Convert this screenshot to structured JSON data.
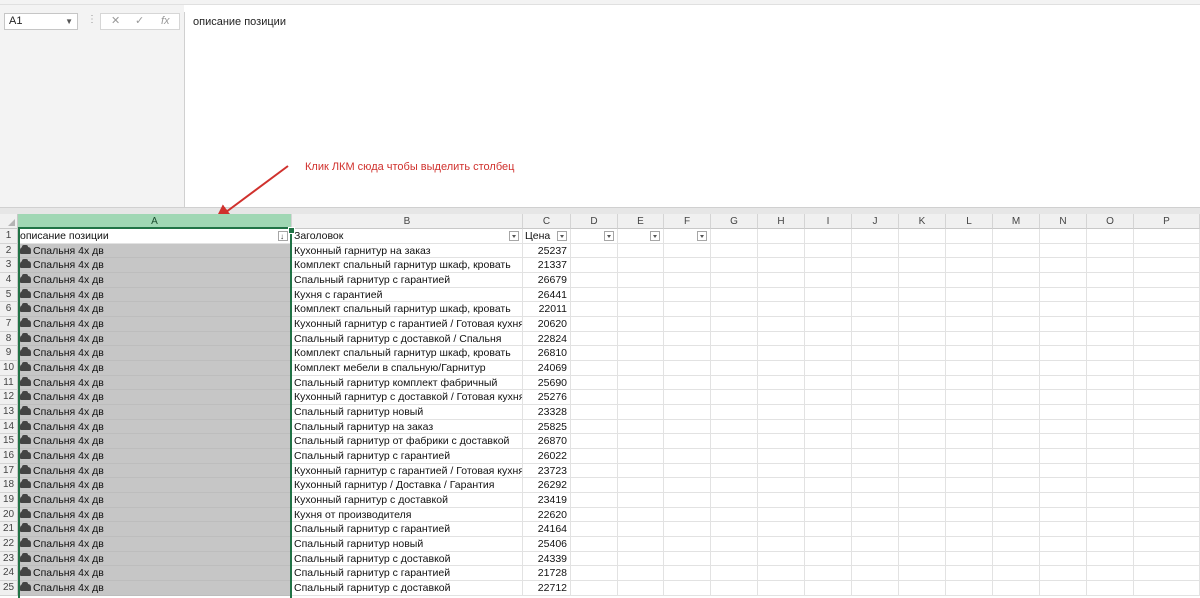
{
  "name_box": {
    "value": "A1"
  },
  "formula_bar": {
    "cancel_label": "✕",
    "enter_label": "✓",
    "fx_label": "fx",
    "content": "описание позиции"
  },
  "annotation": {
    "text": "Клик ЛКМ сюда чтобы выделить столбец",
    "color": "#d0312d"
  },
  "columns": [
    "A",
    "B",
    "C",
    "D",
    "E",
    "F",
    "G",
    "H",
    "I",
    "J",
    "K",
    "L",
    "M",
    "N",
    "O",
    "P"
  ],
  "selected_column": "A",
  "header_row": {
    "a": "описание позиции",
    "b": "Заголовок",
    "c": "Цена"
  },
  "rows": [
    {
      "n": "2",
      "a": "Спальня 4х дв",
      "b": "Кухонный гарнитур на заказ",
      "c": "25237"
    },
    {
      "n": "3",
      "a": "Спальня 4х дв",
      "b": "Комплект спальный гарнитур шкаф, кровать",
      "c": "21337"
    },
    {
      "n": "4",
      "a": "Спальня 4х дв",
      "b": "Спальный гарнитур с гарантией",
      "c": "26679"
    },
    {
      "n": "5",
      "a": "Спальня 4х дв",
      "b": "Кухня с гарантией",
      "c": "26441"
    },
    {
      "n": "6",
      "a": "Спальня 4х дв",
      "b": "Комплект спальный гарнитур шкаф, кровать",
      "c": "22011"
    },
    {
      "n": "7",
      "a": "Спальня 4х дв",
      "b": "Кухонный гарнитур с гарантией / Готовая кухня",
      "c": "20620"
    },
    {
      "n": "8",
      "a": "Спальня 4х дв",
      "b": "Спальный гарнитур с доставкой / Спальня",
      "c": "22824"
    },
    {
      "n": "9",
      "a": "Спальня 4х дв",
      "b": "Комплект спальный гарнитур шкаф, кровать",
      "c": "26810"
    },
    {
      "n": "10",
      "a": "Спальня 4х дв",
      "b": "Комплект мебели в спальную/Гарнитур",
      "c": "24069"
    },
    {
      "n": "11",
      "a": "Спальня 4х дв",
      "b": "Спальный гарнитур комплект фабричный",
      "c": "25690"
    },
    {
      "n": "12",
      "a": "Спальня 4х дв",
      "b": "Кухонный гарнитур с доставкой / Готовая кухня",
      "c": "25276"
    },
    {
      "n": "13",
      "a": "Спальня 4х дв",
      "b": "Спальный гарнитур новый",
      "c": "23328"
    },
    {
      "n": "14",
      "a": "Спальня 4х дв",
      "b": "Спальный гарнитур на заказ",
      "c": "25825"
    },
    {
      "n": "15",
      "a": "Спальня 4х дв",
      "b": "Спальный гарнитур от фабрики с доставкой",
      "c": "26870"
    },
    {
      "n": "16",
      "a": "Спальня 4х дв",
      "b": "Спальный гарнитур с гарантией",
      "c": "26022"
    },
    {
      "n": "17",
      "a": "Спальня 4х дв",
      "b": "Кухонный гарнитур с гарантией / Готовая кухня",
      "c": "23723"
    },
    {
      "n": "18",
      "a": "Спальня 4х дв",
      "b": "Кухонный гарнитур / Доставка / Гарантия",
      "c": "26292"
    },
    {
      "n": "19",
      "a": "Спальня 4х дв",
      "b": "Кухонный гарнитур с доставкой",
      "c": "23419"
    },
    {
      "n": "20",
      "a": "Спальня 4х дв",
      "b": "Кухня от производителя",
      "c": "22620"
    },
    {
      "n": "21",
      "a": "Спальня 4х дв",
      "b": "Спальный гарнитур с гарантией",
      "c": "24164"
    },
    {
      "n": "22",
      "a": "Спальня 4х дв",
      "b": "Спальный гарнитур новый",
      "c": "25406"
    },
    {
      "n": "23",
      "a": "Спальня 4х дв",
      "b": "Спальный гарнитур с доставкой",
      "c": "24339"
    },
    {
      "n": "24",
      "a": "Спальня 4х дв",
      "b": "Спальный гарнитур с гарантией",
      "c": "21728"
    },
    {
      "n": "25",
      "a": "Спальня 4х дв",
      "b": "Спальный гарнитур с доставкой",
      "c": "22712"
    }
  ]
}
